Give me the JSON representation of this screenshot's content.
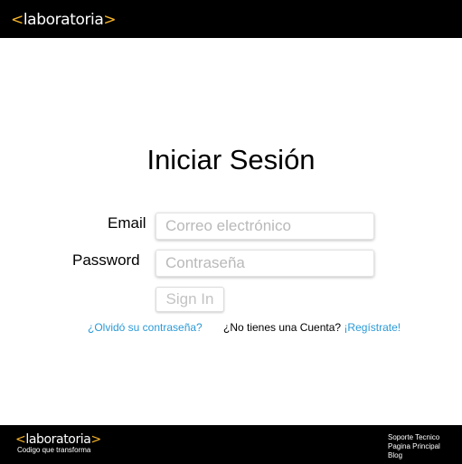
{
  "brand": {
    "bracket_open": "<",
    "name": "laboratoria",
    "bracket_close": ">",
    "accent_color": "#f7b52b"
  },
  "login": {
    "title": "Iniciar Sesión",
    "email_label": "Email",
    "email_placeholder": "Correo electrónico",
    "password_label": "Password",
    "password_placeholder": "Contraseña",
    "signin_label": "Sign In",
    "forgot_link": "¿Olvidó su contraseña?",
    "no_account_text": "¿No tienes una Cuenta?",
    "register_link": "¡Regístrate!",
    "link_color": "#2a9ad6"
  },
  "footer": {
    "tagline": "Codigo que transforma",
    "links": [
      "Soporte Tecnico",
      "Pagina Principal",
      "Blog"
    ]
  }
}
